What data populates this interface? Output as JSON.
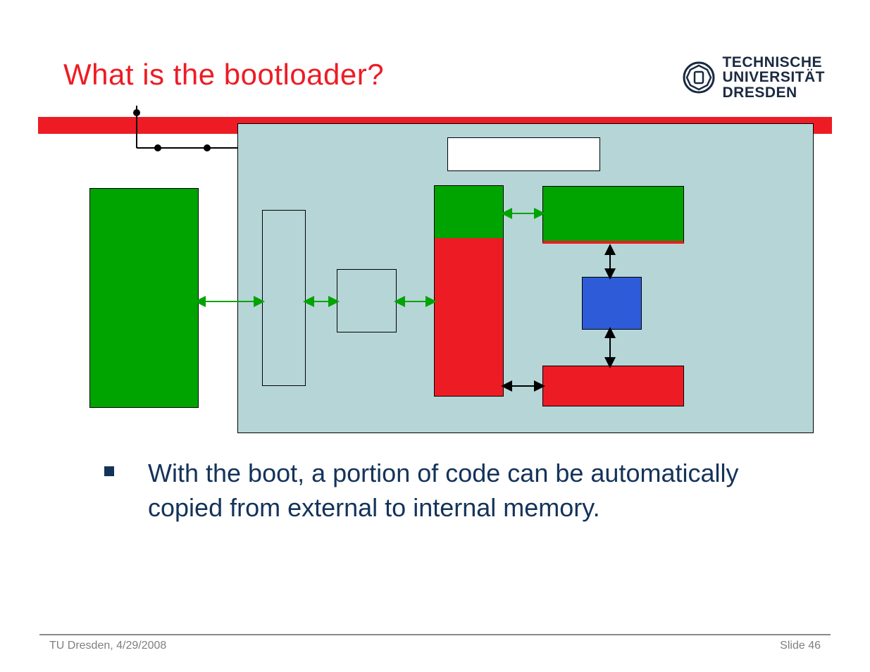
{
  "title": "What is the bootloader?",
  "logo": {
    "line1": "TECHNISCHE",
    "line2": "UNIVERSITÄT",
    "line3": "DRESDEN"
  },
  "bullet": "With the boot, a portion of code can be automatically copied from external to internal memory.",
  "footer_left": "TU Dresden, 4/29/2008",
  "footer_right": "Slide 46",
  "colors": {
    "red": "#ed1c24",
    "green": "#00a400",
    "lightblue": "#b6d5d7",
    "blue": "#2e5bd8",
    "navy": "#14335a"
  },
  "diagram": {
    "blocks": [
      {
        "name": "external-memory",
        "color": "green"
      },
      {
        "name": "panel",
        "color": "lightblue"
      },
      {
        "name": "top-label-box",
        "color": "white"
      },
      {
        "name": "bus-tall",
        "color": "lightblue"
      },
      {
        "name": "bus-small",
        "color": "lightblue"
      },
      {
        "name": "internal-memory",
        "color": "red",
        "top_portion": "green"
      },
      {
        "name": "cache-top",
        "color": "green",
        "underline": "red"
      },
      {
        "name": "cpu-core",
        "color": "blue"
      },
      {
        "name": "peripheral",
        "color": "red"
      }
    ],
    "connections": [
      {
        "from": "external-memory",
        "to": "bus-tall",
        "style": "green-double"
      },
      {
        "from": "bus-tall",
        "to": "bus-small",
        "style": "green-double"
      },
      {
        "from": "bus-small",
        "to": "internal-memory",
        "style": "green-double"
      },
      {
        "from": "internal-memory-top",
        "to": "cache-top",
        "style": "green-double"
      },
      {
        "from": "cache-top",
        "to": "cpu-core",
        "style": "black-double-vertical"
      },
      {
        "from": "cpu-core",
        "to": "peripheral",
        "style": "black-double-vertical"
      },
      {
        "from": "internal-memory",
        "to": "peripheral",
        "style": "black-double"
      }
    ]
  }
}
